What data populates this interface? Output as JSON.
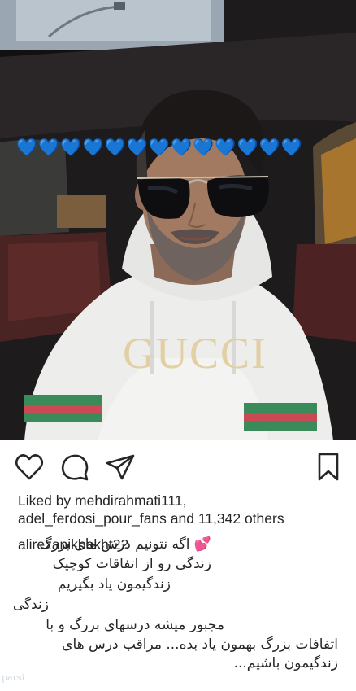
{
  "post": {
    "icons": [
      "heart-icon",
      "comment-icon",
      "share-icon",
      "bookmark-icon"
    ],
    "likes_prefix": "Liked by ",
    "liked_user_1": "mehdirahmati111,",
    "liked_user_2": "adel_ferdosi_pour_fans",
    "likes_and": " and ",
    "likes_count": "11,342 others",
    "caption_user": "alirezanikbakht22",
    "caption_lines": [
      "💕 اگه نتونیم درس های بزرگ",
      "زندگی رو از اتفاقات کوچیک",
      "زندگیمون یاد بگیریم",
      "زندگی",
      "مجبور میشه درسهای بزرگ و با",
      "اتفافات بزرگ بهمون یاد بده... مراقب درس های",
      "زندگیمون باشیم..."
    ],
    "hearts": "💙💙💙💙💙💙💙💙💙💙💙💙💙",
    "watermark": "parsi",
    "photo_print": "GUCCI",
    "colors": {
      "text": "#262626",
      "accent_heart": "#3b82f6",
      "background": "#ffffff"
    }
  }
}
